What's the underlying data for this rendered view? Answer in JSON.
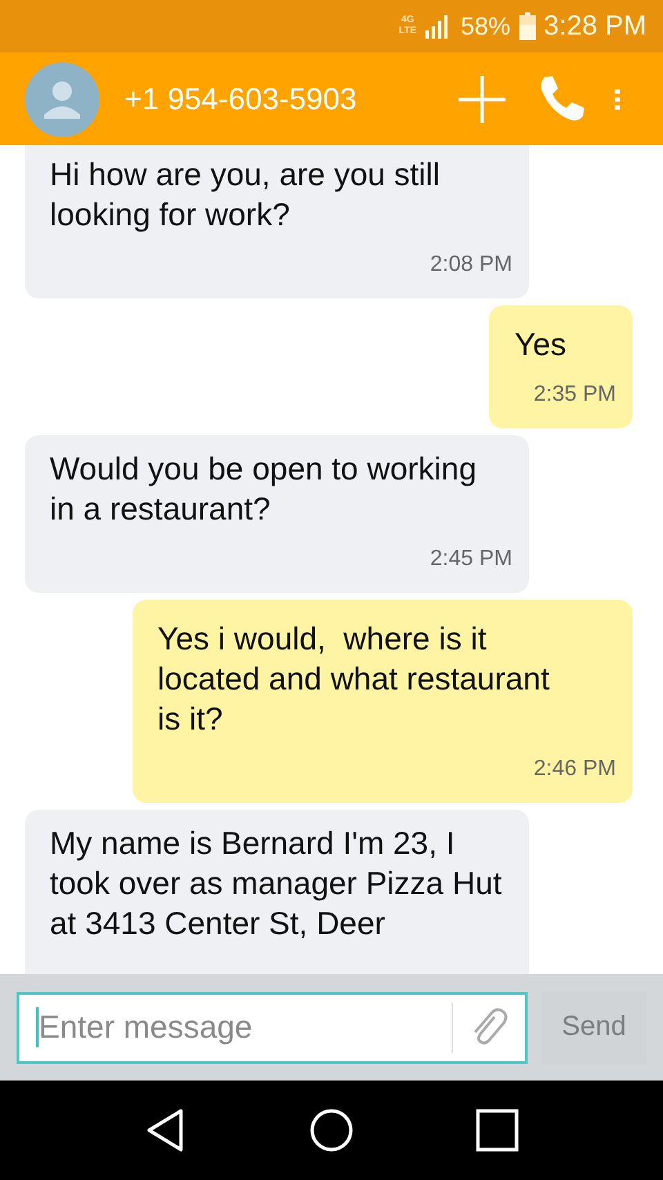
{
  "status_bar": {
    "network": [
      "4G",
      "LTE"
    ],
    "battery": "58%",
    "time": "3:28 PM"
  },
  "header": {
    "contact": "+1 954-603-5903"
  },
  "messages": [
    {
      "kind": "incoming",
      "text": "Hi how are you, are you still looking for work?",
      "time": "2:08 PM"
    },
    {
      "kind": "outgoing",
      "text": "Yes",
      "time": "2:35 PM"
    },
    {
      "kind": "incoming",
      "text": "Would you be open to working in a restaurant?",
      "time": "2:45 PM"
    },
    {
      "kind": "outgoing",
      "text": "Yes i would,  where is it located and what restaurant is it?",
      "time": "2:46 PM"
    },
    {
      "kind": "incoming",
      "text": "My name is Bernard I'm 23, I took over as manager Pizza Hut at 3413 Center St, Deer"
    }
  ],
  "composer": {
    "placeholder": "Enter message",
    "send": {
      "label": "Send",
      "disabled": true
    }
  }
}
